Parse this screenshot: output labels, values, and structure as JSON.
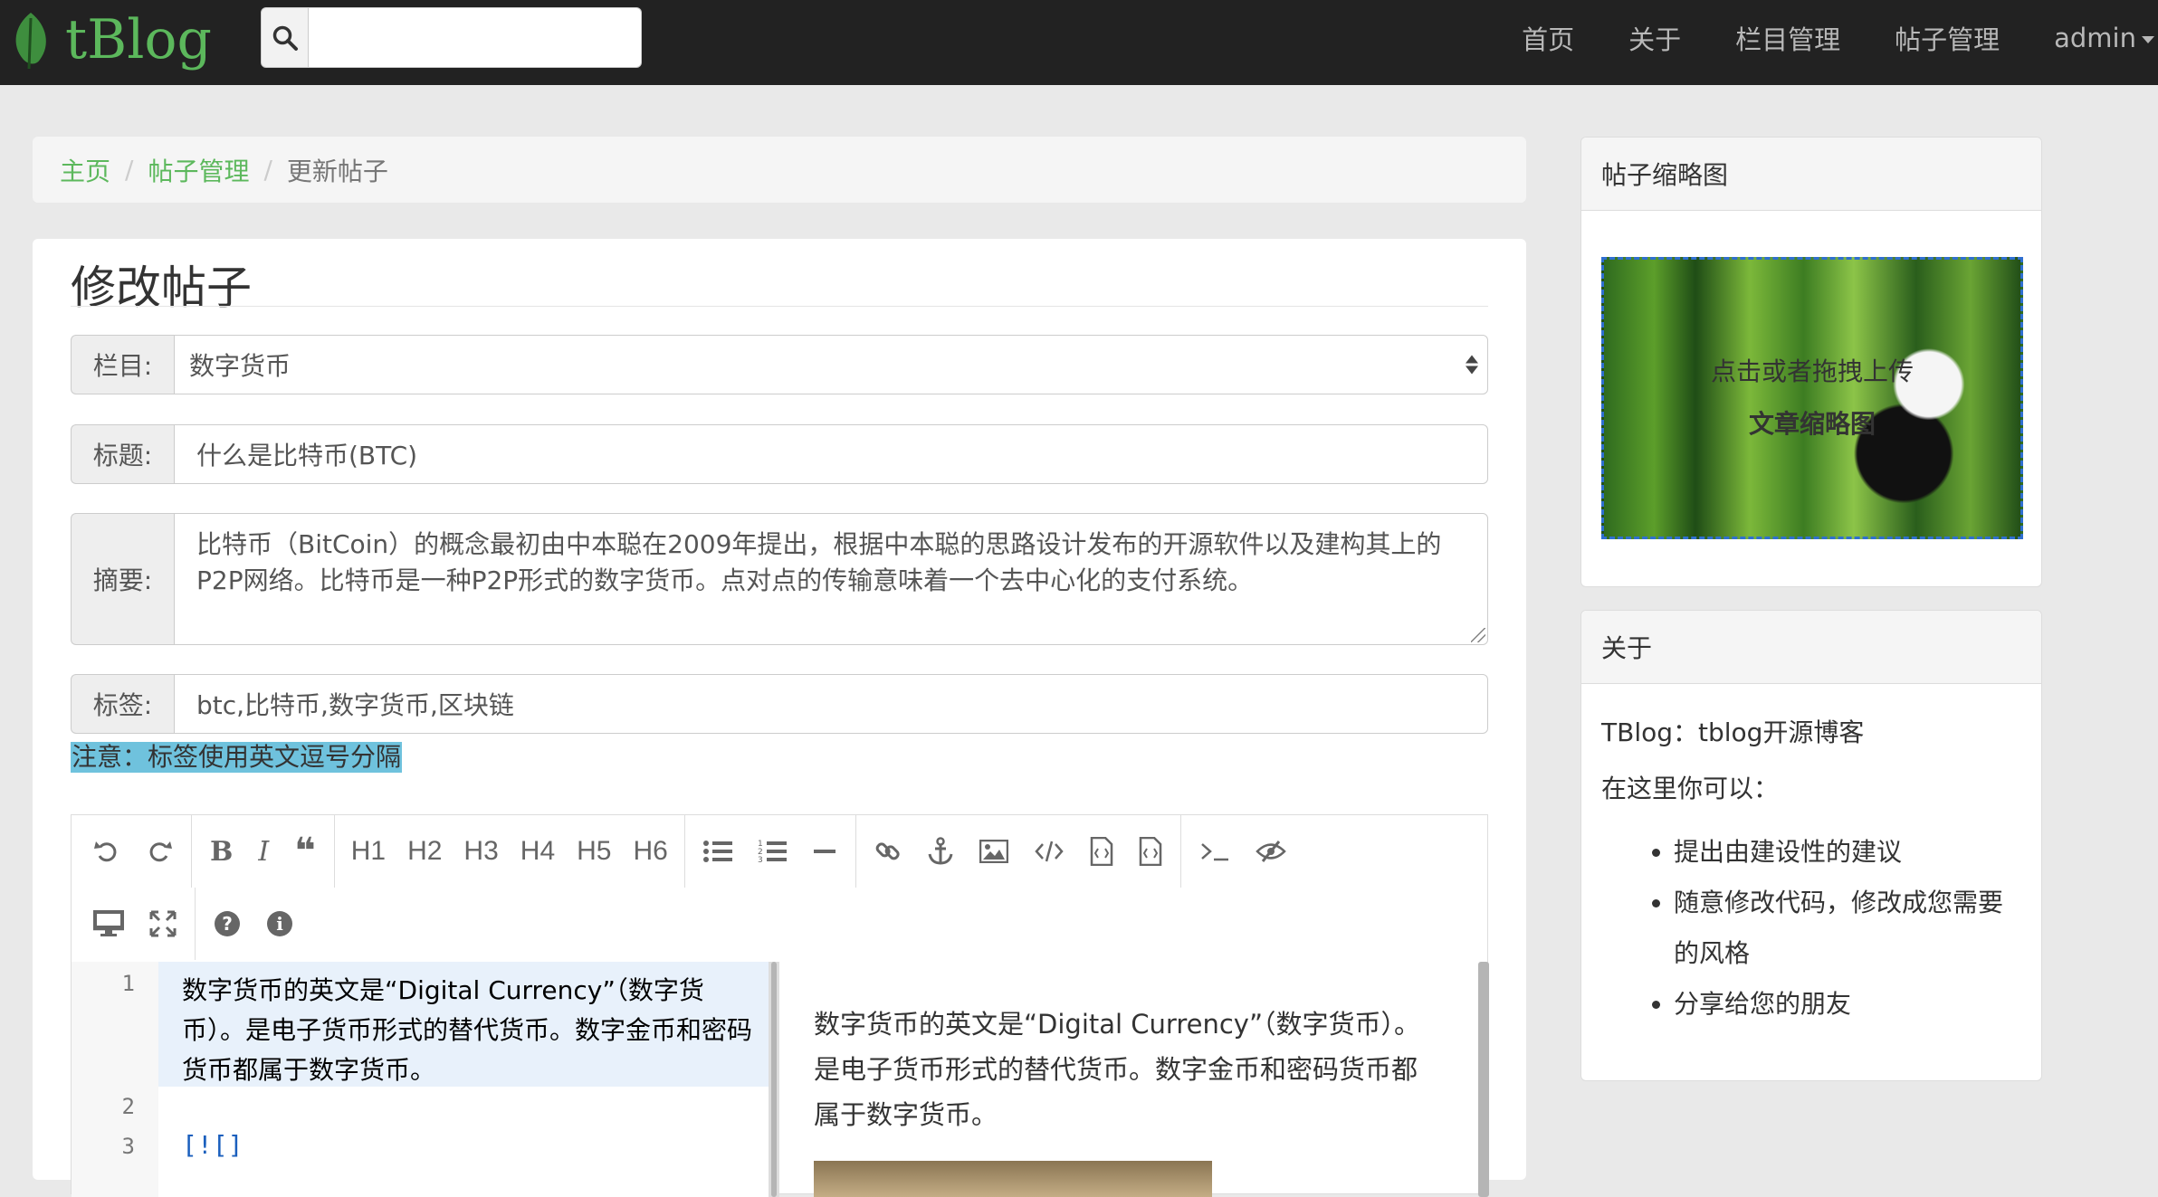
{
  "navbar": {
    "brand": "tBlog",
    "search_placeholder": "",
    "links": [
      "首页",
      "关于",
      "栏目管理",
      "帖子管理"
    ],
    "user": "admin"
  },
  "breadcrumb": [
    "主页",
    "帖子管理",
    "更新帖子"
  ],
  "page_title": "修改帖子",
  "form": {
    "category_label": "栏目:",
    "category_value": "数字货币",
    "title_label": "标题:",
    "title_value": "什么是比特币(BTC)",
    "summary_label": "摘要:",
    "summary_value": "比特币（BitCoin）的概念最初由中本聪在2009年提出，根据中本聪的思路设计发布的开源软件以及建构其上的P2P网络。比特币是一种P2P形式的数字货币。点对点的传输意味着一个去中心化的支付系统。",
    "tags_label": "标签:",
    "tags_value": "btc,比特币,数字货币,区块链",
    "tags_note": "注意：标签使用英文逗号分隔"
  },
  "editor": {
    "toolbar_icons": [
      "undo-icon",
      "redo-icon",
      "bold-icon",
      "italic-icon",
      "quote-icon",
      "h1",
      "h2",
      "h3",
      "h4",
      "h5",
      "h6",
      "unordered-list-icon",
      "ordered-list-icon",
      "hr-icon",
      "link-icon",
      "anchor-icon",
      "image-icon",
      "code-icon",
      "code-block-icon",
      "pre-code-icon",
      "terminal-icon",
      "preview-hide-icon",
      "desktop-icon",
      "fullscreen-icon",
      "help-icon",
      "info-icon"
    ],
    "headings": [
      "H1",
      "H2",
      "H3",
      "H4",
      "H5",
      "H6"
    ],
    "line_numbers": [
      "1",
      "2",
      "3"
    ],
    "code_line1": "数字货币的英文是“Digital Currency”（数字货币）。是电子货币形式的替代货币。数字金币和密码货币都属于数字货币。",
    "code_line3": "[![]",
    "preview_text": "数字货币的英文是“Digital Currency”（数字货币）。是电子货币形式的替代货币。数字金币和密码货币都属于数字货币。"
  },
  "sidebar": {
    "thumb_title": "帖子缩略图",
    "thumb_hint_1": "点击或者拖拽上传",
    "thumb_hint_2": "文章缩略图",
    "about_title": "关于",
    "about_intro": "TBlog：tblog开源博客",
    "about_sub": "在这里你可以：",
    "about_items": [
      "提出由建设性的建议",
      "随意修改代码，修改成您需要的风格",
      "分享给您的朋友"
    ]
  },
  "colors": {
    "brand": "#5cb85c",
    "navbar_bg": "#222222",
    "note_highlight": "#6fc2dd",
    "link": "#5cb85c"
  }
}
